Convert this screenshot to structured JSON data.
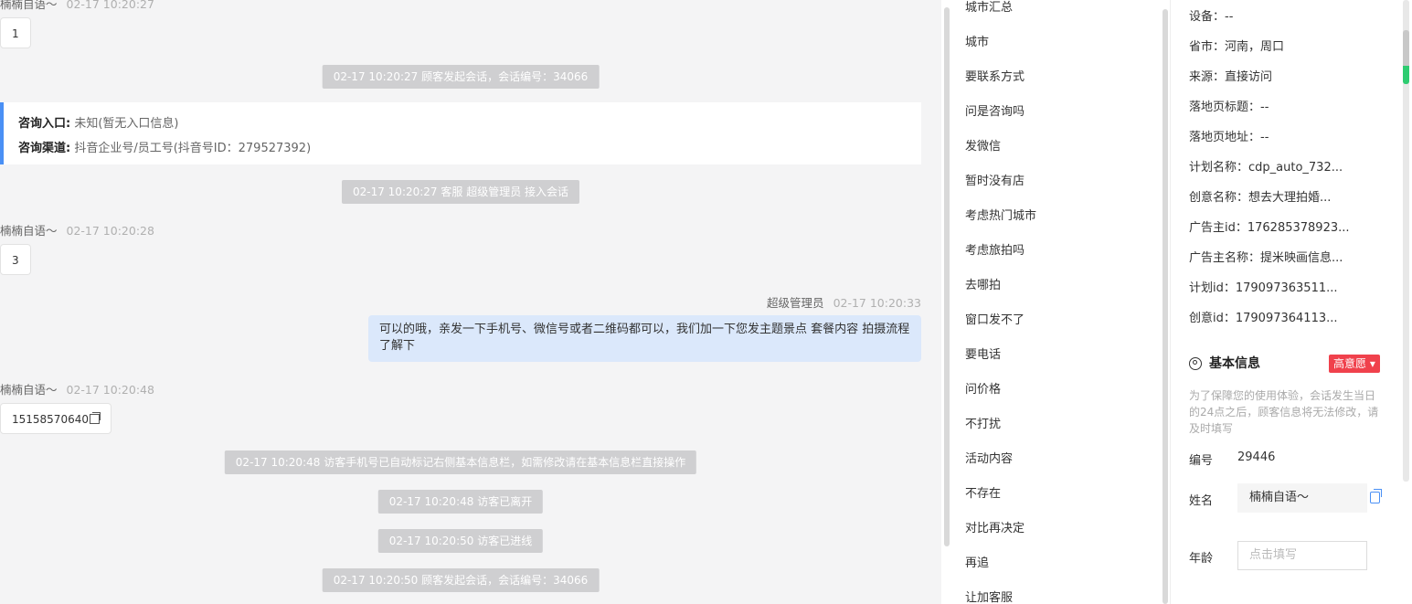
{
  "chat": {
    "msg0": {
      "name": "楠楠自语～",
      "time": "02-17 10:20:27",
      "content": "1"
    },
    "sys1": "02-17 10:20:27 顾客发起会话，会话编号：34066",
    "entry": {
      "entry_label": "咨询入口:",
      "entry_value": "未知(暂无入口信息)",
      "channel_label": "咨询渠道:",
      "channel_value": "抖音企业号/员工号(抖音号ID：279527392)"
    },
    "sys2": "02-17 10:20:27 客服 超级管理员 接入会话",
    "msg1": {
      "name": "楠楠自语～",
      "time": "02-17 10:20:28",
      "content": "3"
    },
    "msg2": {
      "name": "超级管理员",
      "time": "02-17 10:20:33",
      "content": "可以的哦，亲发一下手机号、微信号或者二维码都可以，我们加一下您发主题景点 套餐内容 拍摄流程了解下"
    },
    "msg3": {
      "name": "楠楠自语～",
      "time": "02-17 10:20:48",
      "content": "15158570640"
    },
    "sys3": "02-17 10:20:48 访客手机号已自动标记右侧基本信息栏，如需修改请在基本信息栏直接操作",
    "sys4": "02-17 10:20:48 访客已离开",
    "sys5": "02-17 10:20:50 访客已进线",
    "sys6": "02-17 10:20:50 顾客发起会话，会话编号：34066"
  },
  "tags": [
    "城市汇总",
    "城市",
    "要联系方式",
    "问是咨询吗",
    "发微信",
    "暂时没有店",
    "考虑热门城市",
    "考虑旅拍吗",
    "去哪拍",
    "窗口发不了",
    "要电话",
    "问价格",
    "不打扰",
    "活动内容",
    "不存在",
    "对比再决定",
    "再追",
    "让加客服"
  ],
  "visitor": [
    "设备：--",
    "省市：河南，周口",
    "来源：直接访问",
    "落地页标题：--",
    "落地页地址：--",
    "计划名称：cdp_auto_732...",
    "创意名称：想去大理拍婚...",
    "广告主id：176285378923...",
    "广告主名称：提米映画信息...",
    "计划id：179097363511...",
    "创意id：179097364113..."
  ],
  "basic": {
    "title": "基本信息",
    "intent_badge": "高意愿",
    "note": "为了保障您的使用体验，会话发生当日的24点之后，顾客信息将无法修改，请及时填写",
    "id_label": "编号",
    "id_value": "29446",
    "name_label": "姓名",
    "name_value": "楠楠自语～",
    "age_label": "年龄",
    "age_placeholder": "点击填写"
  },
  "colors": {
    "accent": "#4a90f5",
    "badge": "#f0414c",
    "bubble_agent": "#dbe8fb",
    "system_pill": "#cfcfd1"
  }
}
